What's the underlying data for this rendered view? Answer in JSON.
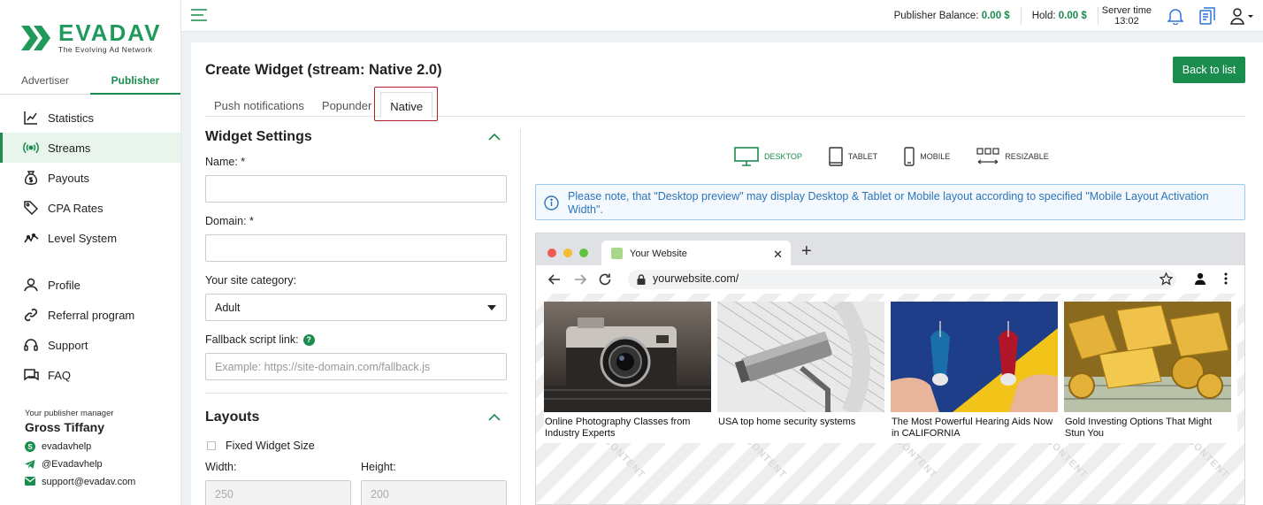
{
  "brand": {
    "name": "EVADAV",
    "tagline": "The Evolving Ad Network",
    "accent": "#1a8c4e"
  },
  "role_tabs": [
    {
      "label": "Advertiser",
      "active": false
    },
    {
      "label": "Publisher",
      "active": true
    }
  ],
  "nav": {
    "primary": [
      {
        "label": "Statistics",
        "icon": "chart-icon"
      },
      {
        "label": "Streams",
        "icon": "broadcast-icon",
        "active": true
      },
      {
        "label": "Payouts",
        "icon": "money-bag-icon"
      },
      {
        "label": "CPA Rates",
        "icon": "tag-icon"
      },
      {
        "label": "Level System",
        "icon": "trend-icon"
      }
    ],
    "secondary": [
      {
        "label": "Profile",
        "icon": "user-icon"
      },
      {
        "label": "Referral program",
        "icon": "link-icon"
      },
      {
        "label": "Support",
        "icon": "headset-icon"
      },
      {
        "label": "FAQ",
        "icon": "chat-icon"
      }
    ]
  },
  "manager": {
    "caption": "Your publisher manager",
    "name": "Gross Tiffany",
    "skype": "evadavhelp",
    "telegram": "@Evadavhelp",
    "email": "support@evadav.com"
  },
  "topbar": {
    "balance_label": "Publisher Balance:",
    "balance_value": "0.00 $",
    "hold_label": "Hold:",
    "hold_value": "0.00 $",
    "server_time_label": "Server time",
    "server_time_value": "13:02"
  },
  "page": {
    "title": "Create Widget (stream: Native 2.0)",
    "back_button": "Back to list",
    "tabs": [
      "Push notifications",
      "Popunder",
      "Native"
    ],
    "active_tab": "Native"
  },
  "widget_settings": {
    "title": "Widget Settings",
    "name_label": "Name: *",
    "name_value": "",
    "domain_label": "Domain: *",
    "domain_value": "",
    "category_label": "Your site category:",
    "category_value": "Adult",
    "fallback_label": "Fallback script link:",
    "fallback_placeholder": "Example: https://site-domain.com/fallback.js"
  },
  "layouts": {
    "title": "Layouts",
    "fixed_size_label": "Fixed Widget Size",
    "fixed_size_checked": false,
    "width_label": "Width:",
    "width_value": "250",
    "height_label": "Height:",
    "height_value": "200"
  },
  "preview": {
    "devices": [
      {
        "label": "DESKTOP",
        "active": true
      },
      {
        "label": "TABLET",
        "active": false
      },
      {
        "label": "MOBILE",
        "active": false
      },
      {
        "label": "RESIZABLE",
        "active": false
      }
    ],
    "notice": "Please note, that \"Desktop preview\" may display Desktop & Tablet or Mobile layout according to specified \"Mobile Layout Activation Width\".",
    "browser_tab_title": "Your Website",
    "url": "yourwebsite.com/",
    "ads": [
      {
        "title": "Online Photography Classes from Industry Experts",
        "image": "camera"
      },
      {
        "title": "USA top home security systems",
        "image": "security-camera"
      },
      {
        "title": "The Most Powerful Hearing Aids Now in CALIFORNIA",
        "image": "hearing-aids"
      },
      {
        "title": "Gold Investing Options That Might Stun You",
        "image": "gold-bars"
      }
    ],
    "watermark": "CONTENT"
  }
}
